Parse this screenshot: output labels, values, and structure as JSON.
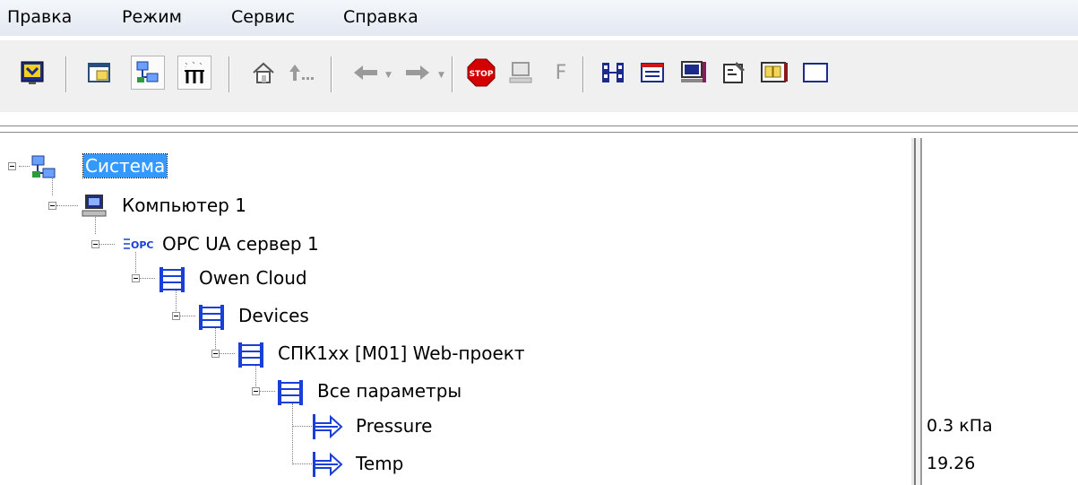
{
  "menu": {
    "items": [
      "Правка",
      "Режим",
      "Сервис",
      "Справка"
    ]
  },
  "toolbar": {
    "buttons": [
      {
        "name": "exit-icon"
      },
      {
        "name": "window-icon"
      },
      {
        "name": "network-view-icon",
        "pressed": true
      },
      {
        "name": "tags-icon",
        "pressed": true
      },
      {
        "name": "home-icon"
      },
      {
        "name": "up-level-icon"
      },
      {
        "name": "back-arrow-icon"
      },
      {
        "name": "forward-arrow-icon"
      },
      {
        "name": "stop-icon",
        "label": "STOP"
      },
      {
        "name": "computer-disabled-icon"
      },
      {
        "name": "letter-f-icon",
        "label": "F"
      },
      {
        "name": "variables-icon"
      },
      {
        "name": "form-icon"
      },
      {
        "name": "monitor-icon"
      },
      {
        "name": "properties-icon"
      },
      {
        "name": "book-icon"
      },
      {
        "name": "blank-window-icon"
      }
    ]
  },
  "tree": {
    "nodes": [
      {
        "label": "Система",
        "icon": "network-icon",
        "selected": true
      },
      {
        "label": "Компьютер 1",
        "icon": "computer-icon"
      },
      {
        "label": "OPC UA сервер 1",
        "icon": "opc-icon",
        "icon_text": "OPC"
      },
      {
        "label": "Owen Cloud",
        "icon": "group-icon"
      },
      {
        "label": "Devices",
        "icon": "group-icon"
      },
      {
        "label": "СПК1xx [M01] Web-проект",
        "icon": "group-icon"
      },
      {
        "label": "Все параметры",
        "icon": "group-icon"
      },
      {
        "label": "Pressure",
        "icon": "tag-arrow-icon"
      },
      {
        "label": "Temp",
        "icon": "tag-arrow-icon"
      }
    ]
  },
  "values": [
    "0.3 кПа",
    "19.26"
  ],
  "colors": {
    "selection": "#3399ff",
    "tree_icon": "#1a3fd8",
    "stop": "#d40000"
  }
}
